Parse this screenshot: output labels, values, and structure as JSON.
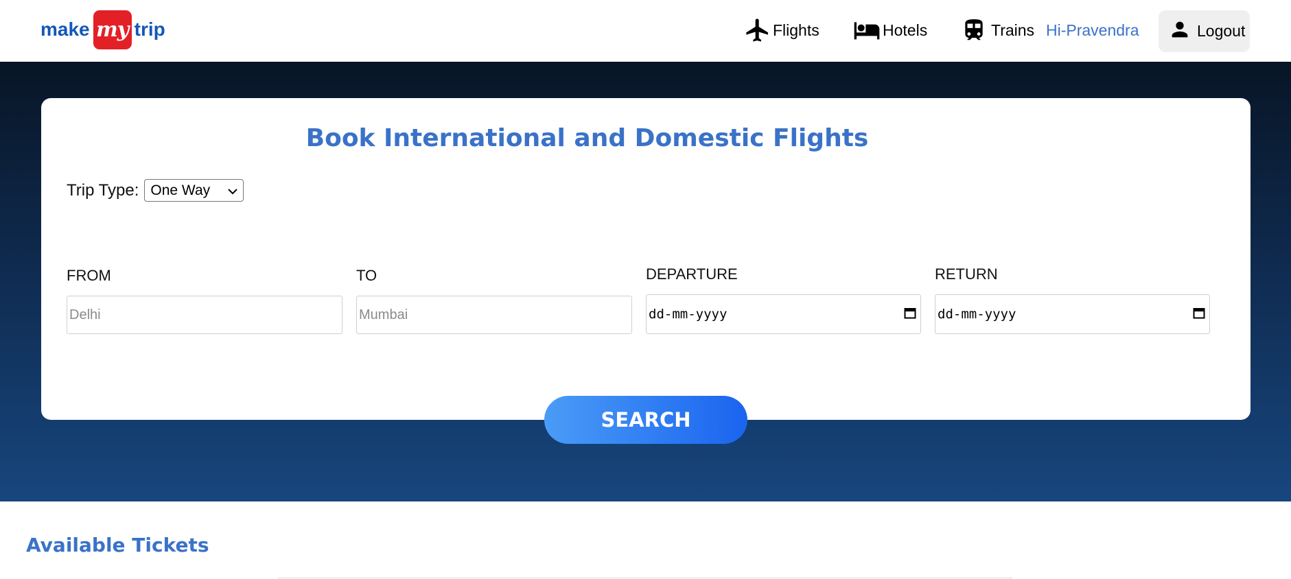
{
  "logo": {
    "left_text": "make",
    "badge_text": "my",
    "right_text": "trip"
  },
  "nav": {
    "flights_label": "Flights",
    "hotels_label": "Hotels",
    "trains_label": "Trains",
    "greeting": "Hi-Pravendra",
    "logout_label": "Logout"
  },
  "booking": {
    "title": "Book International and Domestic Flights",
    "trip_type_label": "Trip Type:",
    "trip_type_value": "One Way",
    "from_label": "FROM",
    "from_placeholder": "Delhi",
    "to_label": "TO",
    "to_placeholder": "Mumbai",
    "departure_label": "DEPARTURE",
    "departure_placeholder": "dd-mm-yyyy",
    "return_label": "RETURN",
    "return_placeholder": "dd-mm-yyyy",
    "search_label": "SEARCH"
  },
  "tickets": {
    "title": "Available Tickets"
  },
  "colors": {
    "brand_blue": "#1457b8",
    "brand_red": "#e42027",
    "accent": "#3a72c8",
    "button_start": "#4a9cf7",
    "button_end": "#1a64ef"
  }
}
